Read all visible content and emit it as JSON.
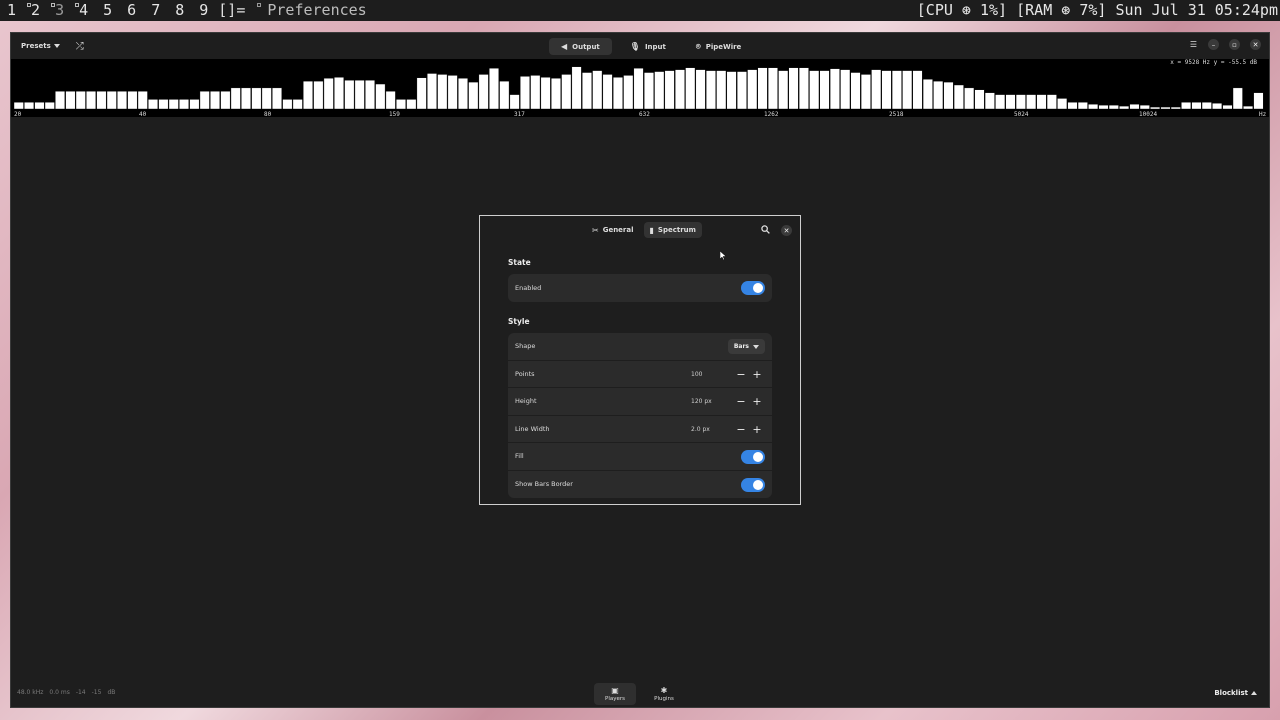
{
  "topbar": {
    "tags": [
      {
        "label": "1",
        "occupied": false
      },
      {
        "label": "2",
        "occupied": true
      },
      {
        "label": "3",
        "occupied": true
      },
      {
        "label": "4",
        "occupied": true
      },
      {
        "label": "5",
        "occupied": false
      },
      {
        "label": "6",
        "occupied": false
      },
      {
        "label": "7",
        "occupied": false
      },
      {
        "label": "8",
        "occupied": false
      },
      {
        "label": "9",
        "occupied": false
      }
    ],
    "layout_symbol": "[]=",
    "window_title": "Preferences",
    "status": "[CPU ⊛ 1%] [RAM ⊛ 7%] Sun Jul 31 05:24pm"
  },
  "window": {
    "presets_label": "Presets",
    "tabs": [
      {
        "label": "Output",
        "icon": "speaker-icon",
        "active": true
      },
      {
        "label": "Input",
        "icon": "microphone-icon",
        "active": false
      },
      {
        "label": "PipeWire",
        "icon": "pipewire-icon",
        "active": false
      }
    ],
    "spectrum": {
      "coordinate_readout": "x = 9528 Hz y = -55.5 dB",
      "frequency_labels": [
        "20",
        "40",
        "80",
        "159",
        "317",
        "632",
        "1262",
        "2518",
        "5024",
        "10024",
        "Hz"
      ],
      "bar_levels": [
        0.14,
        0.14,
        0.14,
        0.14,
        0.37,
        0.37,
        0.37,
        0.37,
        0.37,
        0.37,
        0.37,
        0.37,
        0.37,
        0.2,
        0.2,
        0.2,
        0.2,
        0.2,
        0.37,
        0.37,
        0.37,
        0.44,
        0.44,
        0.44,
        0.44,
        0.44,
        0.2,
        0.2,
        0.58,
        0.58,
        0.64,
        0.66,
        0.6,
        0.6,
        0.6,
        0.52,
        0.37,
        0.2,
        0.2,
        0.65,
        0.74,
        0.72,
        0.7,
        0.64,
        0.56,
        0.72,
        0.85,
        0.58,
        0.3,
        0.68,
        0.7,
        0.66,
        0.64,
        0.72,
        0.88,
        0.76,
        0.8,
        0.72,
        0.66,
        0.7,
        0.85,
        0.76,
        0.78,
        0.8,
        0.82,
        0.86,
        0.82,
        0.8,
        0.8,
        0.78,
        0.78,
        0.82,
        0.86,
        0.86,
        0.8,
        0.86,
        0.86,
        0.8,
        0.8,
        0.84,
        0.82,
        0.76,
        0.72,
        0.82,
        0.8,
        0.8,
        0.8,
        0.8,
        0.62,
        0.58,
        0.56,
        0.5,
        0.44,
        0.4,
        0.34,
        0.3,
        0.3,
        0.3,
        0.3,
        0.3,
        0.3,
        0.22,
        0.14,
        0.14,
        0.1,
        0.08,
        0.08,
        0.06,
        0.1,
        0.08,
        0.04,
        0.04,
        0.04,
        0.14,
        0.14,
        0.14,
        0.12,
        0.08,
        0.44,
        0.06,
        0.34
      ]
    },
    "bottom": {
      "latency_items": [
        "48.0 kHz",
        "0.0 ms",
        "-14",
        "-15",
        "dB"
      ],
      "tabs": [
        {
          "label": "Players",
          "icon": "player-icon",
          "active": true
        },
        {
          "label": "Plugins",
          "icon": "plugin-icon",
          "active": false
        }
      ],
      "blocklist_label": "Blocklist"
    }
  },
  "dialog": {
    "tabs": [
      {
        "label": "General",
        "icon": "tools-icon",
        "active": false
      },
      {
        "label": "Spectrum",
        "icon": "bar-chart-icon",
        "active": true
      }
    ],
    "sections": {
      "state": {
        "title": "State",
        "rows": [
          {
            "label": "Enabled",
            "control": "toggle",
            "value": true
          }
        ]
      },
      "style": {
        "title": "Style",
        "shape_label": "Shape",
        "shape_value": "Bars",
        "points_label": "Points",
        "points_value": "100",
        "height_label": "Height",
        "height_value": "120 px",
        "line_width_label": "Line Width",
        "line_width_value": "2.0 px",
        "fill_label": "Fill",
        "fill_value": true,
        "show_bars_border_label": "Show Bars Border",
        "show_bars_border_value": true
      }
    }
  },
  "colors": {
    "accent": "#3584e4",
    "window_bg": "#1e1e1e",
    "card_bg": "#2b2b2b"
  }
}
